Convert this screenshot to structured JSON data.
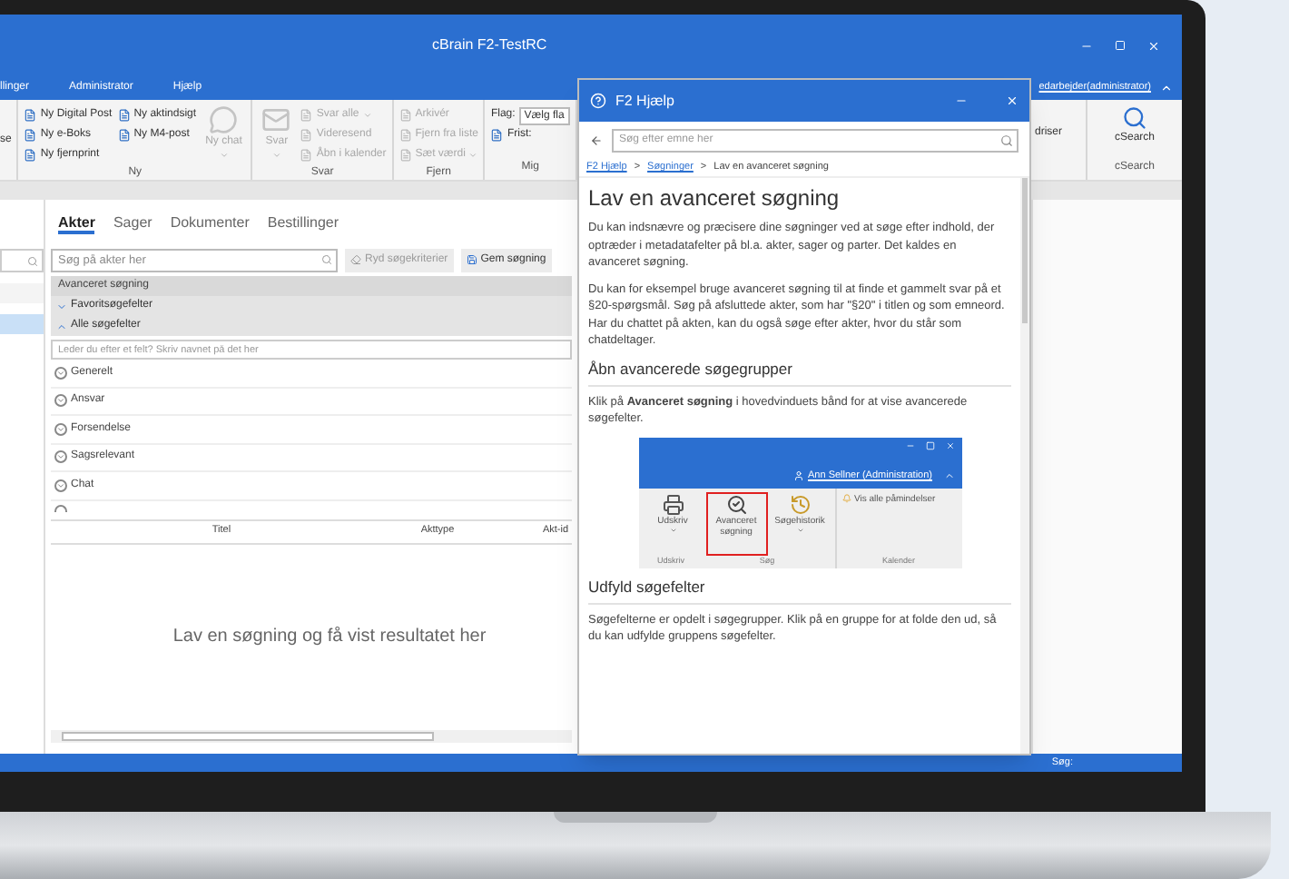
{
  "window": {
    "title": "cBrain F2-TestRC"
  },
  "menu": {
    "items": [
      {
        "label": "llinger"
      },
      {
        "label": "Administrator"
      },
      {
        "label": "Hjælp"
      }
    ],
    "user": "edarbejder(administrator)"
  },
  "ribbon": {
    "left_fragment": "se",
    "groups": [
      {
        "label": "Ny",
        "columns": [
          [
            {
              "kind": "small",
              "label": "Ny Digital Post",
              "disabled": false
            },
            {
              "kind": "small",
              "label": "Ny e-Boks",
              "disabled": false
            },
            {
              "kind": "small",
              "label": "Ny fjernprint",
              "disabled": false
            }
          ],
          [
            {
              "kind": "small",
              "label": "Ny aktindsigt",
              "disabled": false
            },
            {
              "kind": "small",
              "label": "Ny M4-post",
              "disabled": false
            }
          ],
          [
            {
              "kind": "large",
              "label": "Ny chat",
              "dropdown": true,
              "disabled": true
            }
          ]
        ]
      },
      {
        "label": "Svar",
        "columns": [
          [
            {
              "kind": "large",
              "label": "Svar",
              "dropdown": true,
              "disabled": true
            }
          ],
          [
            {
              "kind": "small",
              "label": "Svar alle",
              "dropdown": true,
              "disabled": true
            },
            {
              "kind": "small",
              "label": "Videresend",
              "disabled": true
            },
            {
              "kind": "small",
              "label": "Åbn i kalender",
              "disabled": true
            }
          ]
        ]
      },
      {
        "label": "Fjern",
        "columns": [
          [
            {
              "kind": "small",
              "label": "Arkivér",
              "disabled": true
            },
            {
              "kind": "small",
              "label": "Fjern fra liste",
              "disabled": true
            },
            {
              "kind": "small",
              "label": "Sæt værdi",
              "dropdown": true,
              "disabled": true
            }
          ]
        ]
      },
      {
        "label": "Mig",
        "columns": [
          [
            {
              "kind": "field",
              "label": "Flag:",
              "value": "Vælg fla",
              "disabled": false
            },
            {
              "kind": "small",
              "label": "Frist:",
              "disabled": false
            }
          ]
        ]
      }
    ],
    "right_fragment": "driser",
    "right_group": {
      "label": "cSearch",
      "button": "cSearch"
    }
  },
  "sidebar": {
    "items": [
      {
        "selected": false
      },
      {
        "selected": true
      }
    ]
  },
  "tabs": [
    {
      "label": "Akter",
      "selected": true
    },
    {
      "label": "Sager",
      "selected": false
    },
    {
      "label": "Dokumenter",
      "selected": false
    },
    {
      "label": "Bestillinger",
      "selected": false
    }
  ],
  "search": {
    "placeholder": "Søg på akter her"
  },
  "buttons": [
    {
      "label": "Ryd søgekriterier",
      "disabled": true
    },
    {
      "label": "Gem søgning",
      "disabled": false
    }
  ],
  "advanced": {
    "title": "Avanceret søgning",
    "sections": [
      {
        "label": "Favoritsøgefelter",
        "expanded": false
      },
      {
        "label": "Alle søgefelter",
        "expanded": true
      }
    ],
    "filter_placeholder": "Leder du efter et felt? Skriv navnet på det her",
    "groups": [
      "Generelt",
      "Ansvar",
      "Forsendelse",
      "Sagsrelevant",
      "Chat"
    ]
  },
  "table": {
    "columns": [
      "Titel",
      "Akttype",
      "Akt-id"
    ],
    "empty_message": "Lav en søgning og få vist resultatet her"
  },
  "help": {
    "title": "F2 Hjælp",
    "search_placeholder": "Søg efter emne her",
    "separator": ">",
    "breadcrumb": [
      {
        "label": "F2 Hjælp",
        "link": true
      },
      {
        "label": "Søgninger",
        "link": true
      },
      {
        "label": "Lav en avanceret søgning",
        "link": false
      }
    ],
    "content": [
      {
        "kind": "heading",
        "text": "Lav en avanceret søgning"
      },
      {
        "kind": "paragraph",
        "text": "Du kan indsnævre og præcisere dine søgninger ved at søge efter indhold, der optræder i metadatafelter på bl.a. akter, sager og parter. Det kaldes en avanceret søgning."
      },
      {
        "kind": "paragraph",
        "text": "Du kan for eksempel bruge avanceret søgning til at finde et gammelt svar på et §20-spørgsmål. Søg på afsluttede akter, som har \"§20\" i titlen og som emneord. Har du chattet på akten, kan du også søge efter akter, hvor du står som chatdeltager."
      },
      {
        "kind": "subheading",
        "text": "Åbn avancerede søgegrupper"
      },
      {
        "kind": "paragraph",
        "text": "Klik på **Avanceret søgning** i hovedvinduets bånd for at vise avancerede søgefelter."
      },
      {
        "kind": "screenshot",
        "user": "Ann Sellner (Administration)",
        "buttons": [
          {
            "label": "Udskriv",
            "dropdown": true,
            "highlighted": false
          },
          {
            "label": "Avanceret søgning",
            "dropdown": false,
            "highlighted": true
          },
          {
            "label": "Søgehistorik",
            "dropdown": true,
            "highlighted": false
          }
        ],
        "reminder": "Vis alle påmindelser",
        "group_labels": [
          "Udskriv",
          "Søg",
          "Kalender"
        ]
      },
      {
        "kind": "subheading",
        "text": "Udfyld søgefelter"
      },
      {
        "kind": "paragraph",
        "text": "Søgefelterne er opdelt i søgegrupper. Klik på en gruppe for at folde den ud, så du kan udfylde gruppens søgefelter."
      }
    ]
  },
  "status_bar": {
    "text": "Søg:"
  }
}
